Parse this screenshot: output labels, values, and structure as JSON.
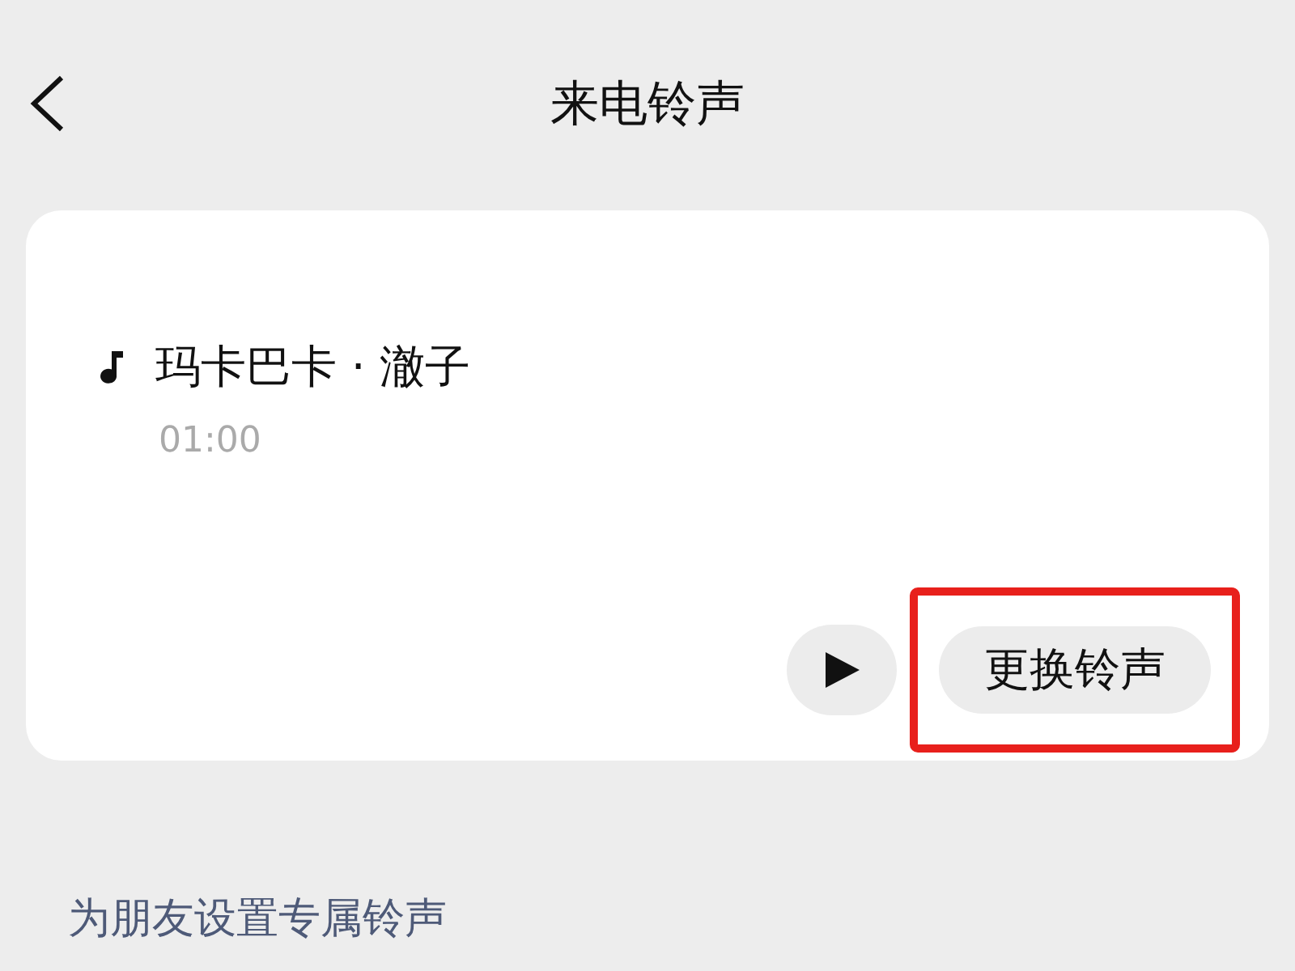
{
  "header": {
    "title": "来电铃声"
  },
  "ringtone": {
    "name": "玛卡巴卡 · 澈子",
    "duration": "01:00"
  },
  "change_button": {
    "label": "更换铃声",
    "highlighted": true
  },
  "friend_link": {
    "label": "为朋友设置专属铃声"
  }
}
